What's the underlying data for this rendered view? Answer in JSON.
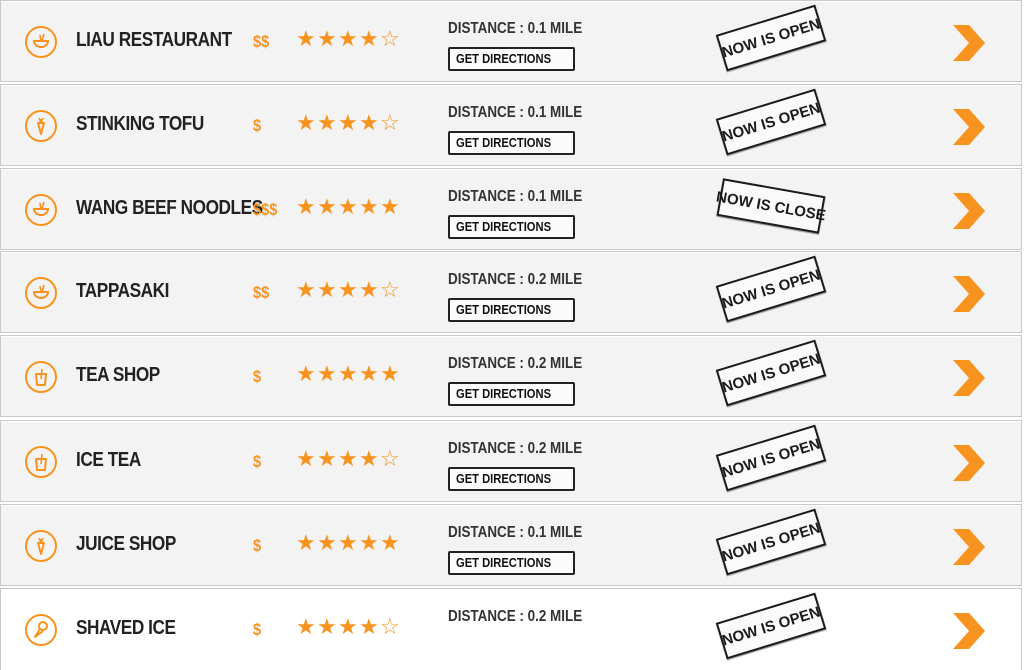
{
  "distance_prefix": "DISTANCE : ",
  "directions_label": "GET DIRECTIONS",
  "accent_color": "#f7931e",
  "restaurants": [
    {
      "name": "LIAU RESTAURANT",
      "price": "$$",
      "rating": 4,
      "distance": "0.1 MILE",
      "status": "NOW IS OPEN",
      "status_kind": "open",
      "icon": "noodle-bowl-icon"
    },
    {
      "name": "STINKING TOFU",
      "price": "$",
      "rating": 4,
      "distance": "0.1 MILE",
      "status": "NOW IS OPEN",
      "status_kind": "open",
      "icon": "carrot-icon"
    },
    {
      "name": "WANG BEEF NOODLES",
      "price": "$$$",
      "rating": 5,
      "distance": "0.1 MILE",
      "status": "NOW IS CLOSE",
      "status_kind": "close",
      "icon": "noodle-bowl-icon"
    },
    {
      "name": "TAPPASAKI",
      "price": "$$",
      "rating": 4,
      "distance": "0.2 MILE",
      "status": "NOW IS OPEN",
      "status_kind": "open",
      "icon": "noodle-bowl-icon"
    },
    {
      "name": "TEA SHOP",
      "price": "$",
      "rating": 5,
      "distance": "0.2 MILE",
      "status": "NOW IS OPEN",
      "status_kind": "open",
      "icon": "drink-cup-icon"
    },
    {
      "name": "ICE TEA",
      "price": "$",
      "rating": 4,
      "distance": "0.2 MILE",
      "status": "NOW IS OPEN",
      "status_kind": "open",
      "icon": "drink-cup-icon"
    },
    {
      "name": "JUICE SHOP",
      "price": "$",
      "rating": 5,
      "distance": "0.1 MILE",
      "status": "NOW IS OPEN",
      "status_kind": "open",
      "icon": "carrot-icon"
    },
    {
      "name": "SHAVED ICE",
      "price": "$",
      "rating": 4,
      "distance": "0.2 MILE",
      "status": "NOW IS OPEN",
      "status_kind": "open",
      "icon": "ice-cone-icon"
    }
  ]
}
